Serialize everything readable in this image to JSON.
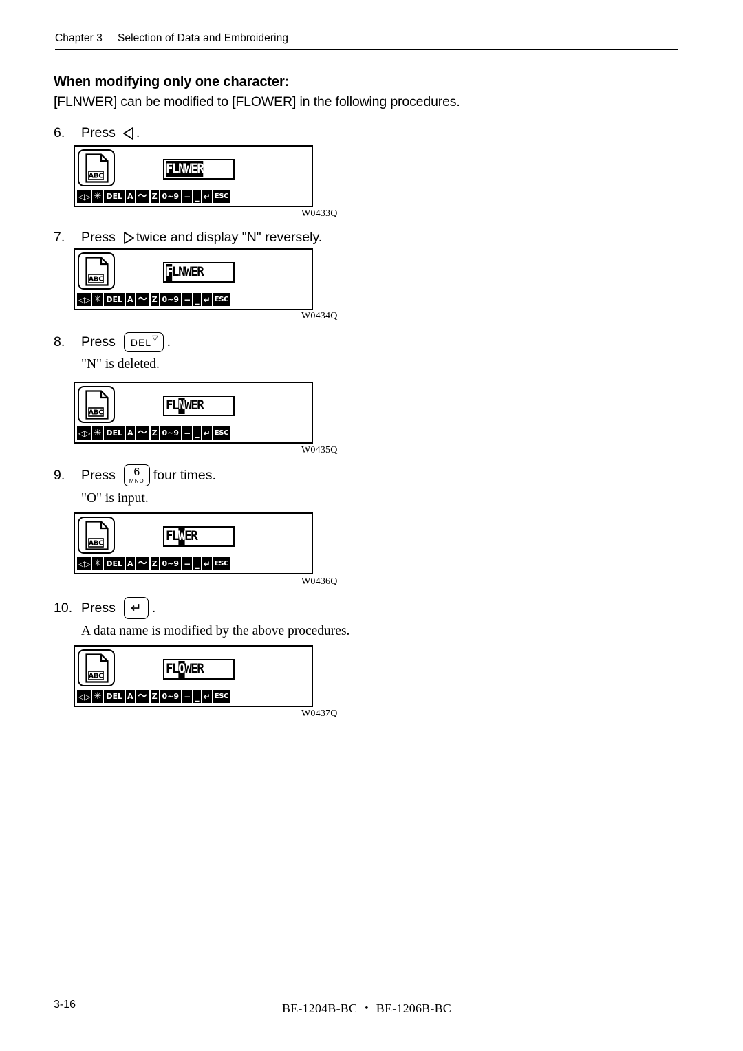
{
  "header": {
    "chapter": "Chapter 3",
    "title": "Selection of Data and Embroidering"
  },
  "intro": {
    "title": "When modifying only one character:",
    "description": "[FLNWER] can be modified to [FLOWER] in the following procedures."
  },
  "lcd_toolbar": {
    "keys": [
      {
        "name": "arrow-left-right-key",
        "label": "◁▷"
      },
      {
        "name": "asterisk-key",
        "label": "✳"
      },
      {
        "name": "del-key",
        "label": "DEL"
      },
      {
        "name": "letter-a-key",
        "label": "A"
      },
      {
        "name": "tilde-key",
        "label": "～"
      },
      {
        "name": "letter-z-key",
        "label": "Z"
      },
      {
        "name": "digits-key",
        "label": "0~9"
      },
      {
        "name": "hyphen-key",
        "label": "−"
      },
      {
        "name": "underscore-key",
        "label": "_"
      },
      {
        "name": "enter-key",
        "label": "↵"
      },
      {
        "name": "esc-key",
        "label": "ESC"
      }
    ]
  },
  "steps": [
    {
      "number": "6.",
      "press_word": "Press",
      "key_type": "triangle-left",
      "key_label": "◁",
      "tail": ".",
      "note": "",
      "display": {
        "icon_label": "ABC",
        "segments": [
          {
            "text": "FLNWER",
            "inverted": true
          }
        ]
      },
      "figure": "W0433Q"
    },
    {
      "number": "7.",
      "press_word": "Press",
      "key_type": "triangle-right",
      "key_label": "▷",
      "tail": "twice and display \"N\" reversely.",
      "note": "",
      "display": {
        "icon_label": "ABC",
        "segments": [
          {
            "text": "F",
            "inverted": true
          },
          {
            "text": "LNWER",
            "inverted": false
          }
        ]
      },
      "figure": "W0434Q"
    },
    {
      "number": "8.",
      "press_word": "Press",
      "key_type": "keycap-del",
      "key_label": "DEL",
      "key_sup": "▽",
      "tail": ".",
      "note": "\"N\" is deleted.",
      "display": {
        "icon_label": "ABC",
        "segments": [
          {
            "text": "FL",
            "inverted": false
          },
          {
            "text": "N",
            "inverted": true
          },
          {
            "text": "WER",
            "inverted": false
          }
        ]
      },
      "figure": "W0435Q"
    },
    {
      "number": "9.",
      "press_word": "Press",
      "key_type": "keycap-number",
      "key_label": "6",
      "key_sub": "MNO",
      "tail": "four times.",
      "note": "\"O\" is input.",
      "display": {
        "icon_label": "ABC",
        "segments": [
          {
            "text": "FL",
            "inverted": false
          },
          {
            "text": "W",
            "inverted": true
          },
          {
            "text": "ER",
            "inverted": false
          }
        ]
      },
      "figure": "W0436Q"
    },
    {
      "number": "10.",
      "press_word": "Press",
      "key_type": "keycap-enter",
      "key_label": "↵",
      "tail": ".",
      "note": "A data name is modified by the above procedures.",
      "display": {
        "icon_label": "ABC",
        "segments": [
          {
            "text": "FL",
            "inverted": false
          },
          {
            "text": "O",
            "inverted": true
          },
          {
            "text": "WER",
            "inverted": false
          }
        ]
      },
      "figure": "W0437Q"
    }
  ],
  "footer": {
    "page_number": "3-16",
    "model": "BE-1204B-BC ・ BE-1206B-BC"
  }
}
